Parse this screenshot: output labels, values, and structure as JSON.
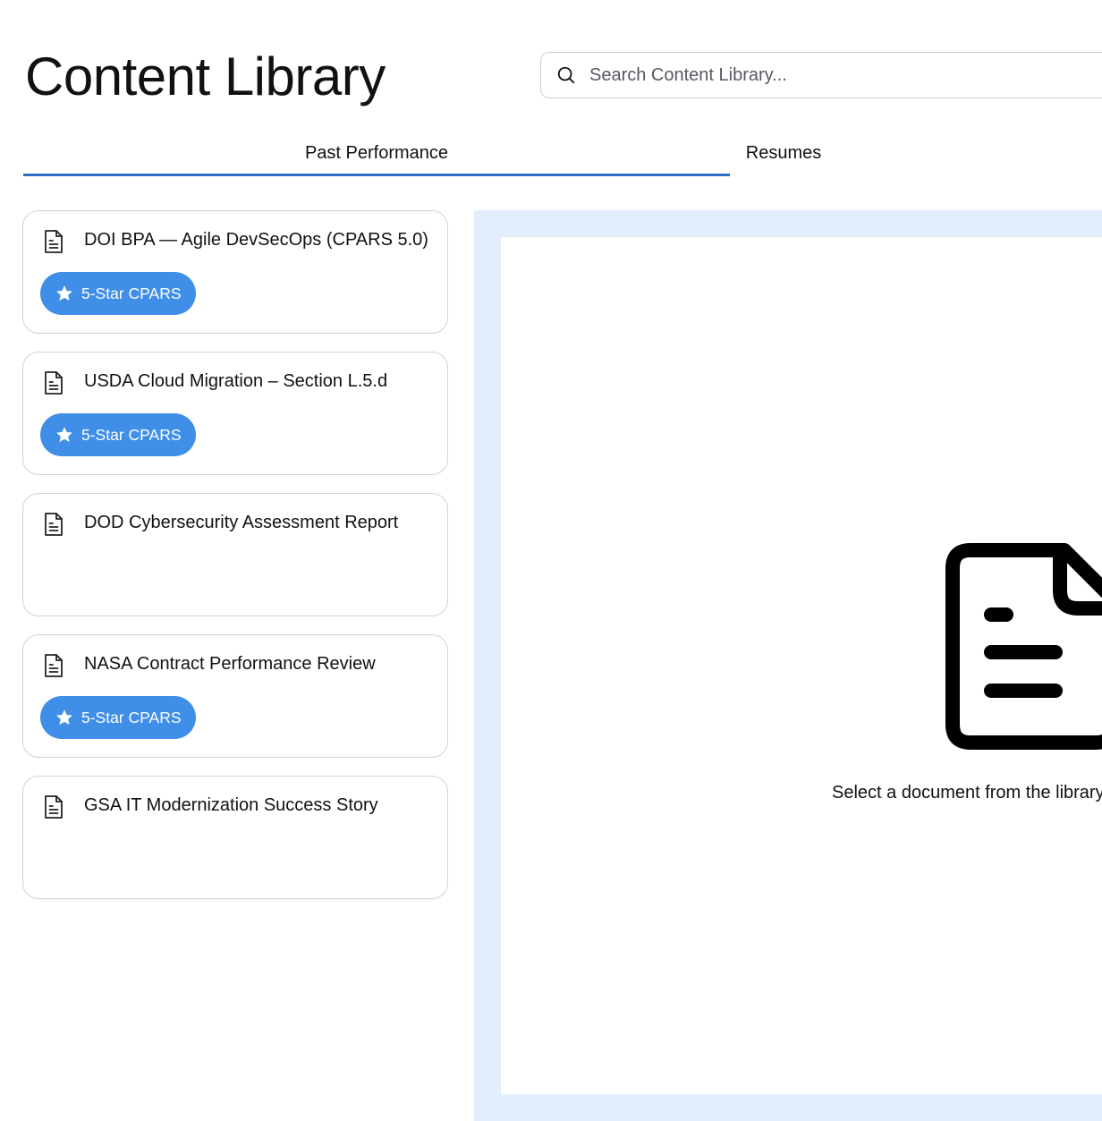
{
  "header": {
    "title": "Content Library",
    "search_placeholder": "Search Content Library..."
  },
  "tabs": [
    {
      "label": "Past Performance",
      "active": true
    },
    {
      "label": "Resumes",
      "active": false
    }
  ],
  "documents": [
    {
      "title": "DOI BPA — Agile DevSecOps (CPARS 5.0)",
      "badge": "5-Star CPARS"
    },
    {
      "title": "USDA Cloud Migration – Section L.5.d",
      "badge": "5-Star CPARS"
    },
    {
      "title": "DOD Cybersecurity Assessment Report",
      "badge": null
    },
    {
      "title": "NASA Contract Performance Review",
      "badge": "5-Star CPARS"
    },
    {
      "title": "GSA IT Modernization Success Story",
      "badge": null
    }
  ],
  "preview": {
    "empty_message": "Select a document from the library to preview"
  },
  "colors": {
    "accent": "#2a6fc0",
    "badge": "#3f8ee8",
    "preview_bg": "#e3eefc"
  }
}
